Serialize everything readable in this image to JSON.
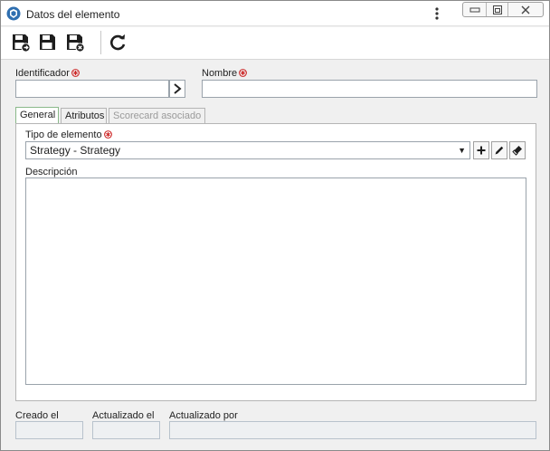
{
  "window": {
    "title": "Datos del elemento",
    "controls": [
      "minimize-icon",
      "maximize-icon",
      "close-icon"
    ]
  },
  "toolbar": {
    "buttons": [
      {
        "name": "save-and-new",
        "icon": "save-plus-icon"
      },
      {
        "name": "save",
        "icon": "save-icon"
      },
      {
        "name": "save-and-close",
        "icon": "save-close-icon"
      },
      {
        "name": "refresh",
        "icon": "refresh-icon"
      }
    ]
  },
  "form": {
    "identifier_label": "Identificador",
    "identifier_value": "",
    "name_label": "Nombre",
    "name_value": ""
  },
  "tabs": [
    {
      "label": "General",
      "state": "active"
    },
    {
      "label": "Atributos",
      "state": "normal"
    },
    {
      "label": "Scorecard asociado",
      "state": "disabled"
    }
  ],
  "general": {
    "element_type_label": "Tipo de elemento",
    "element_type_value": "Strategy - Strategy",
    "description_label": "Descripción",
    "description_value": ""
  },
  "footer": {
    "created_label": "Creado el",
    "created_value": "",
    "updated_label": "Actualizado el",
    "updated_value": "",
    "updated_by_label": "Actualizado por",
    "updated_by_value": ""
  },
  "colors": {
    "required": "#cc2222",
    "active_tab_border": "#8ab98a",
    "input_border": "#9aa3ab",
    "icon": "#1e1e1e"
  }
}
